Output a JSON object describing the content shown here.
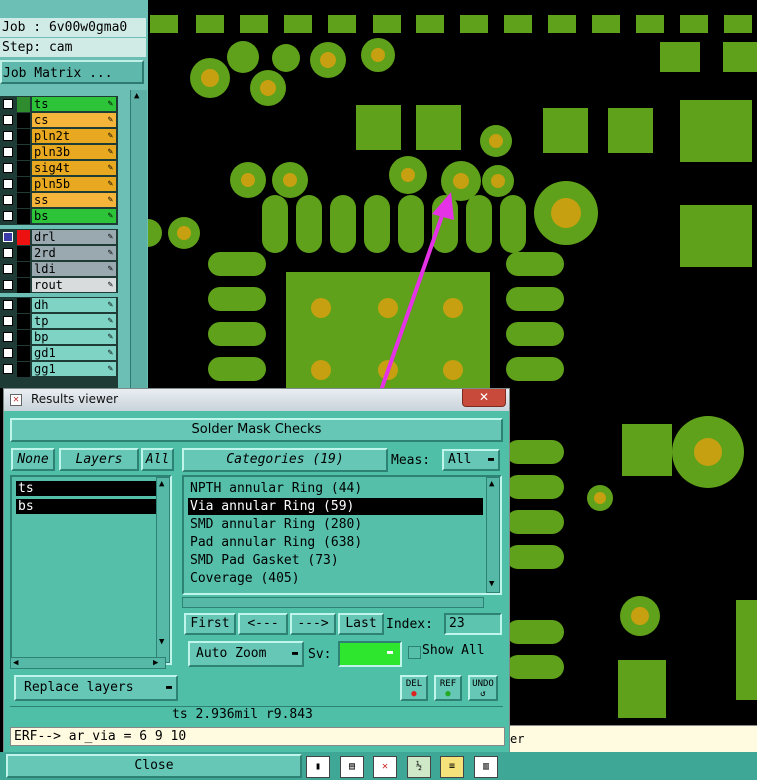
{
  "job_info": {
    "job_line": "Job : 6v00w0gma0",
    "step_line": "Step: cam",
    "job_matrix_button": "Job Matrix ..."
  },
  "layers": {
    "group1": [
      {
        "name": "ts",
        "color": "#2ec43a",
        "swatch": "#2e8b2e"
      },
      {
        "name": "cs",
        "color": "#f5b53a",
        "swatch": "#000000"
      },
      {
        "name": "pln2t",
        "color": "#e8a820",
        "swatch": "#000000"
      },
      {
        "name": "pln3b",
        "color": "#e8a820",
        "swatch": "#000000"
      },
      {
        "name": "sig4t",
        "color": "#e8a820",
        "swatch": "#000000"
      },
      {
        "name": "pln5b",
        "color": "#e8a820",
        "swatch": "#000000"
      },
      {
        "name": "ss",
        "color": "#f5b53a",
        "swatch": "#000000"
      },
      {
        "name": "bs",
        "color": "#2ec43a",
        "swatch": "#000000"
      }
    ],
    "group2": [
      {
        "name": "drl",
        "color": "#9aa9b0",
        "swatch": "#ee1111",
        "checked": true
      },
      {
        "name": "2rd",
        "color": "#9aa9b0",
        "swatch": "#000000"
      },
      {
        "name": "ldi",
        "color": "#9aa9b0",
        "swatch": "#000000"
      },
      {
        "name": "rout",
        "color": "#d8dcdc",
        "swatch": "#000000"
      }
    ],
    "group3": [
      {
        "name": "dh",
        "color": "#7fd3c5",
        "swatch": "#000000"
      },
      {
        "name": "tp",
        "color": "#7fd3c5",
        "swatch": "#000000"
      },
      {
        "name": "bp",
        "color": "#7fd3c5",
        "swatch": "#000000"
      },
      {
        "name": "gd1",
        "color": "#7fd3c5",
        "swatch": "#000000"
      },
      {
        "name": "gg1",
        "color": "#7fd3c5",
        "swatch": "#000000"
      }
    ]
  },
  "results_viewer": {
    "window_title": "Results viewer",
    "close_glyph": "✕",
    "heading": "Solder Mask Checks",
    "none_button": "None",
    "layers_button": "Layers",
    "all_button": "All",
    "categories_button": "Categories (19)",
    "meas_label": "Meas:",
    "meas_value": "All",
    "layer_items": [
      "ts",
      "bs"
    ],
    "categories": [
      {
        "label": "NPTH annular Ring (44)",
        "selected": false
      },
      {
        "label": "Via annular Ring (59)",
        "selected": true
      },
      {
        "label": "SMD annular Ring (280)",
        "selected": false
      },
      {
        "label": "Pad annular Ring (638)",
        "selected": false
      },
      {
        "label": "SMD Pad Gasket (73)",
        "selected": false
      },
      {
        "label": "Coverage (405)",
        "selected": false
      }
    ],
    "first_button": "First",
    "prev_button": "<---",
    "next_button": "--->",
    "last_button": "Last",
    "index_label": "Index:",
    "index_value": "23",
    "auto_zoom_button": "Auto Zoom",
    "sv_label": "Sv:",
    "show_all_label": "Show All",
    "replace_layers_button": "Replace layers",
    "del_label": "DEL",
    "ref_label": "REF",
    "undo_label": "UNDO",
    "status_text": "ts 2.936mil  r9.843",
    "erf_text": "ERF--> ar_via = 6 9 10",
    "erf_ext_text": "er",
    "close_button": "Close"
  },
  "colors": {
    "pcb_copper": "#5fa11b",
    "pcb_drill": "#c6a010",
    "pcb_background": "#000000",
    "annotation_arrow": "#e632e6",
    "panel_teal": "#4fbfa8"
  }
}
